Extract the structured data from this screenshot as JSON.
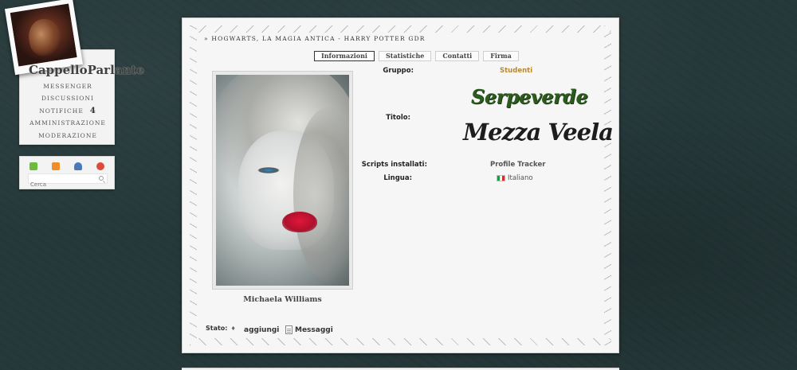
{
  "user": {
    "name": "CappelloParlante",
    "menu": [
      {
        "label": "MESSENGER",
        "count": ""
      },
      {
        "label": "DISCUSSIONI",
        "count": ""
      },
      {
        "label": "NOTIFICHE",
        "count": "4"
      },
      {
        "label": "AMMINISTRAZIONE",
        "count": ""
      },
      {
        "label": "MODERAZIONE",
        "count": ""
      }
    ]
  },
  "tools": {
    "icons": [
      "edit-icon",
      "rss-icon",
      "user-icon",
      "logout-icon"
    ],
    "search_placeholder": "Cerca"
  },
  "forum": {
    "breadcrumb": "» HOGWARTS, LA MAGIA ANTICA - HARRY POTTER GDR"
  },
  "tabs": [
    {
      "label": "Informazioni",
      "active": true
    },
    {
      "label": "Statistiche",
      "active": false
    },
    {
      "label": "Contatti",
      "active": false
    },
    {
      "label": "Firma",
      "active": false
    }
  ],
  "profile": {
    "character_name": "Michaela Williams",
    "fields": {
      "group_label": "Gruppo:",
      "group_value": "Studenti",
      "title_label": "Titolo:",
      "house": "Serpeverde",
      "title_value": "Mezza Veela",
      "scripts_label": "Scripts installati:",
      "scripts_value": "Profile Tracker",
      "language_label": "Lingua:",
      "language_value": "Italiano"
    },
    "status_label": "Stato:",
    "status_action": "aggiungi",
    "messages_label": "Messaggi"
  },
  "colors": {
    "background": "#26393a",
    "group_accent": "#b38a3a",
    "house_green": "#2c5a1f"
  }
}
